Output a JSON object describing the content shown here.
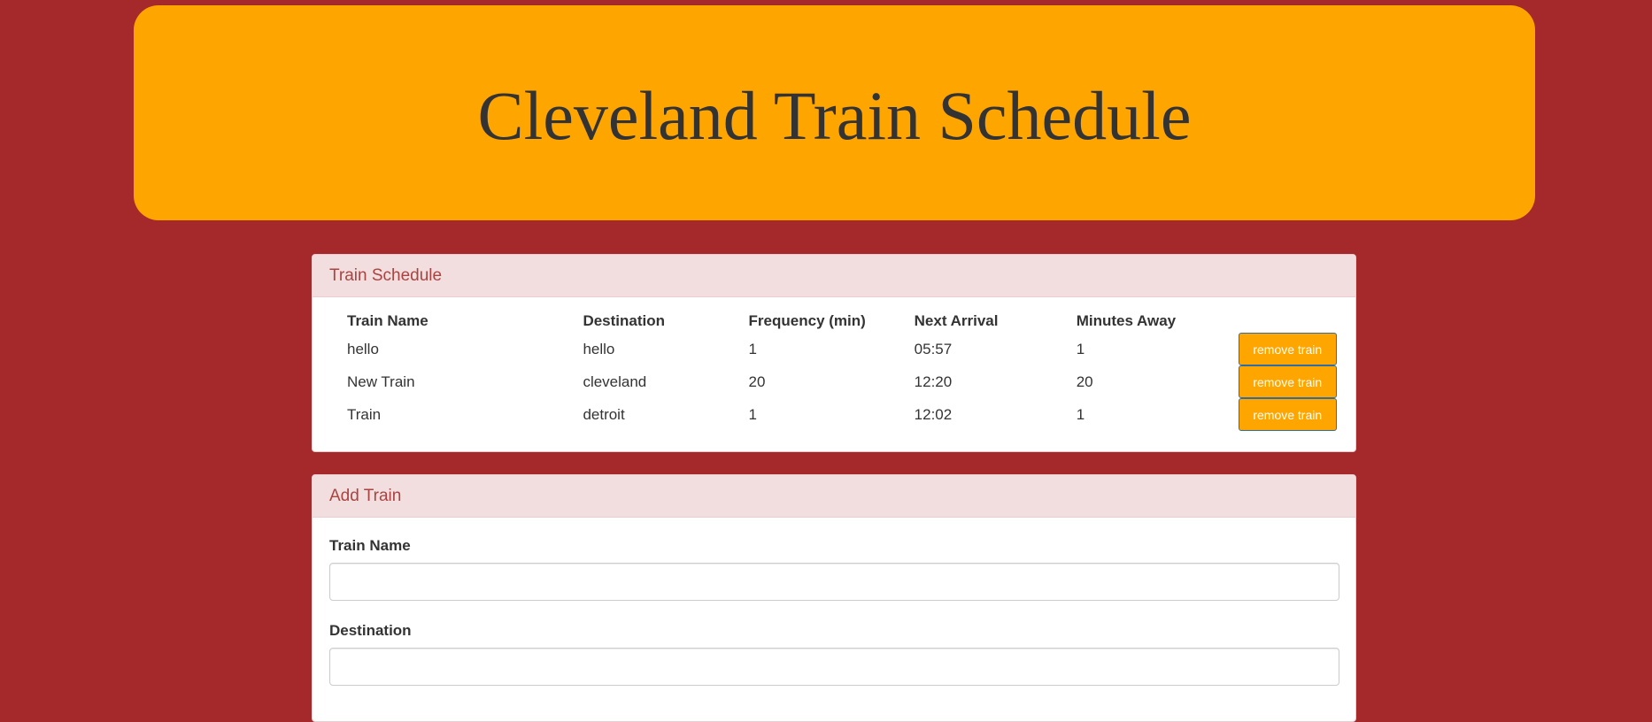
{
  "header": {
    "title": "Cleveland Train Schedule"
  },
  "schedule": {
    "panel_title": "Train Schedule",
    "columns": [
      "Train Name",
      "Destination",
      "Frequency (min)",
      "Next Arrival",
      "Minutes Away",
      ""
    ],
    "rows": [
      {
        "name": "hello",
        "destination": "hello",
        "frequency": "1",
        "next_arrival": "05:57",
        "minutes_away": "1",
        "action_label": "remove train"
      },
      {
        "name": "New Train",
        "destination": "cleveland",
        "frequency": "20",
        "next_arrival": "12:20",
        "minutes_away": "20",
        "action_label": "remove train"
      },
      {
        "name": "Train",
        "destination": "detroit",
        "frequency": "1",
        "next_arrival": "12:02",
        "minutes_away": "1",
        "action_label": "remove train"
      }
    ]
  },
  "add_train": {
    "panel_title": "Add Train",
    "fields": [
      {
        "label": "Train Name",
        "value": ""
      },
      {
        "label": "Destination",
        "value": ""
      }
    ]
  },
  "colors": {
    "page_background": "#a5292a",
    "header_background": "#ffa500",
    "panel_heading_background": "#f2dede",
    "panel_heading_text": "#a94442",
    "button_background": "#ffa500",
    "button_border": "#2e6da4"
  }
}
